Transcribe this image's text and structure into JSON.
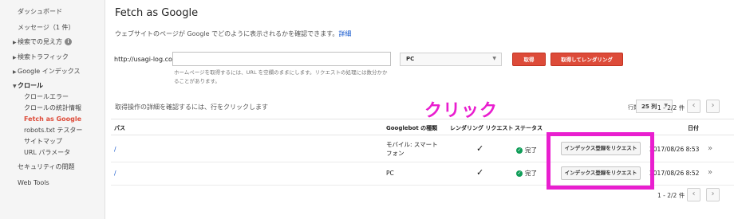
{
  "sidebar": {
    "items": [
      {
        "label": "ダッシュボード"
      },
      {
        "label": "メッセージ（1 件）"
      },
      {
        "label": "検索での見え方"
      },
      {
        "label": "検索トラフィック"
      },
      {
        "label": "Google インデックス"
      },
      {
        "label": "クロール"
      },
      {
        "label": "クロールエラー"
      },
      {
        "label": "クロールの統計情報"
      },
      {
        "label": "Fetch as Google"
      },
      {
        "label": "robots.txt テスター"
      },
      {
        "label": "サイトマップ"
      },
      {
        "label": "URL パラメータ"
      },
      {
        "label": "セキュリティの問題"
      },
      {
        "label": "Web Tools"
      }
    ],
    "info_icon": "i"
  },
  "header": {
    "title": "Fetch as Google",
    "description": "ウェブサイトのページが Google でどのように表示されるかを確認できます。",
    "details_link": "詳細"
  },
  "fetch_form": {
    "domain": "http://usagi-log.com/",
    "url_value": "",
    "device": "PC",
    "fetch_label": "取得",
    "fetch_render_label": "取得してレンダリング",
    "hint": "ホームページを取得するには、URL を空欄のままにします。リクエストの処理には数分かかることがあります。"
  },
  "table": {
    "caption": "取得操作の詳細を確認するには、行をクリックします",
    "rows_label": "行数",
    "rows_per_page": "25 列",
    "pagination": "1 - 2/2 件",
    "headers": {
      "path": "パス",
      "googlebot": "Googlebot の種類",
      "rendering": "レンダリング リクエスト",
      "status": "ステータス",
      "date": "日付"
    },
    "rows": [
      {
        "path": "/",
        "googlebot": "モバイル: スマートフォン",
        "googlebot_line1": "モバイル: スマート",
        "googlebot_line2": "フォン",
        "rendering": "✓",
        "status": "完了",
        "request_label": "インデックス登録をリクエスト",
        "date": "2017/08/26 8:53"
      },
      {
        "path": "/",
        "googlebot": "PC",
        "rendering": "✓",
        "status": "完了",
        "request_label": "インデックス登録をリクエスト",
        "date": "2017/08/26 8:52"
      }
    ]
  },
  "annotation": {
    "text": "クリック",
    "color": "#e91ecf"
  },
  "colors": {
    "accent_red": "#dd4b39",
    "link_blue": "#1155cc",
    "status_green": "#0f9d58",
    "highlight_magenta": "#e91ecf"
  },
  "icons": {
    "prev": "‹",
    "next": "›",
    "expand": "»",
    "status_ok": "✓",
    "dropdown": "▼"
  }
}
